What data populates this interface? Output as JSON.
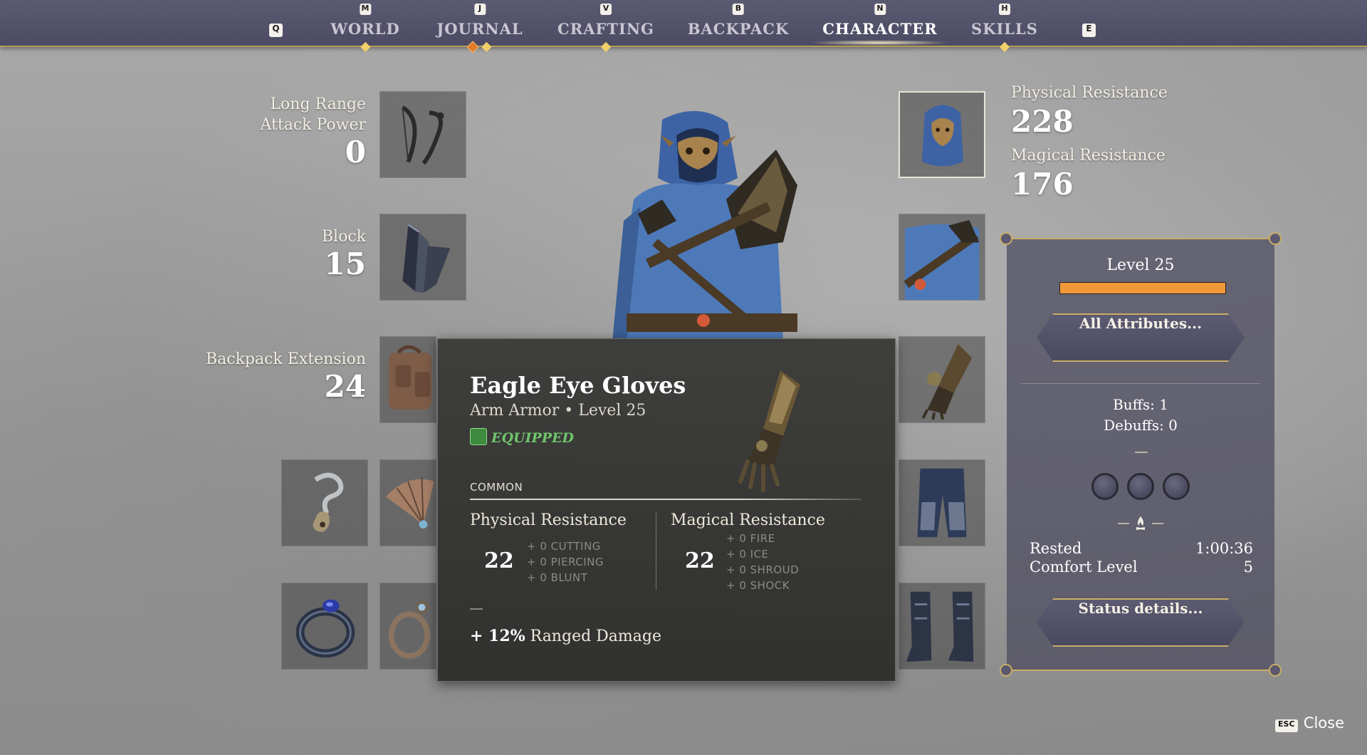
{
  "nav": {
    "left_key": "Q",
    "right_key": "E",
    "tabs": [
      {
        "key": "M",
        "label": "WORLD"
      },
      {
        "key": "J",
        "label": "JOURNAL"
      },
      {
        "key": "V",
        "label": "CRAFTING"
      },
      {
        "key": "B",
        "label": "BACKPACK"
      },
      {
        "key": "N",
        "label": "CHARACTER"
      },
      {
        "key": "H",
        "label": "SKILLS"
      }
    ],
    "active": "CHARACTER"
  },
  "left_stats": {
    "ranged": {
      "name_line1": "Long Range",
      "name_line2": "Attack Power",
      "value": "0"
    },
    "block": {
      "name": "Block",
      "value": "15"
    },
    "backpack": {
      "name": "Backpack Extension",
      "value": "24"
    }
  },
  "right_stats": {
    "physical": {
      "name": "Physical Resistance",
      "value": "228"
    },
    "magical": {
      "name": "Magical Resistance",
      "value": "176"
    }
  },
  "tooltip": {
    "item_name": "Eagle Eye Gloves",
    "item_type": "Arm Armor",
    "item_level": "Level 25",
    "subtitle_sep": "•",
    "equipped": "EQUIPPED",
    "rarity": "COMMON",
    "physical": {
      "label": "Physical Resistance",
      "value": "22",
      "subs": [
        "+ 0 CUTTING",
        "+ 0 PIERCING",
        "+ 0 BLUNT"
      ]
    },
    "magical": {
      "label": "Magical Resistance",
      "value": "22",
      "subs": [
        "+ 0 FIRE",
        "+ 0 ICE",
        "+ 0 SHROUD",
        "+ 0 SHOCK"
      ]
    },
    "bonus_value": "+ 12%",
    "bonus_label": "Ranged Damage"
  },
  "status": {
    "level": "Level 25",
    "xp_fraction": 1.0,
    "xp_color": "#f1993a",
    "all_attributes": "All Attributes...",
    "buffs": "Buffs: 1",
    "debuffs": "Debuffs: 0",
    "rested_label": "Rested",
    "rested_value": "1:00:36",
    "comfort_label": "Comfort Level",
    "comfort_value": "5",
    "status_details": "Status details..."
  },
  "close": {
    "key": "ESC",
    "label": "Close"
  }
}
